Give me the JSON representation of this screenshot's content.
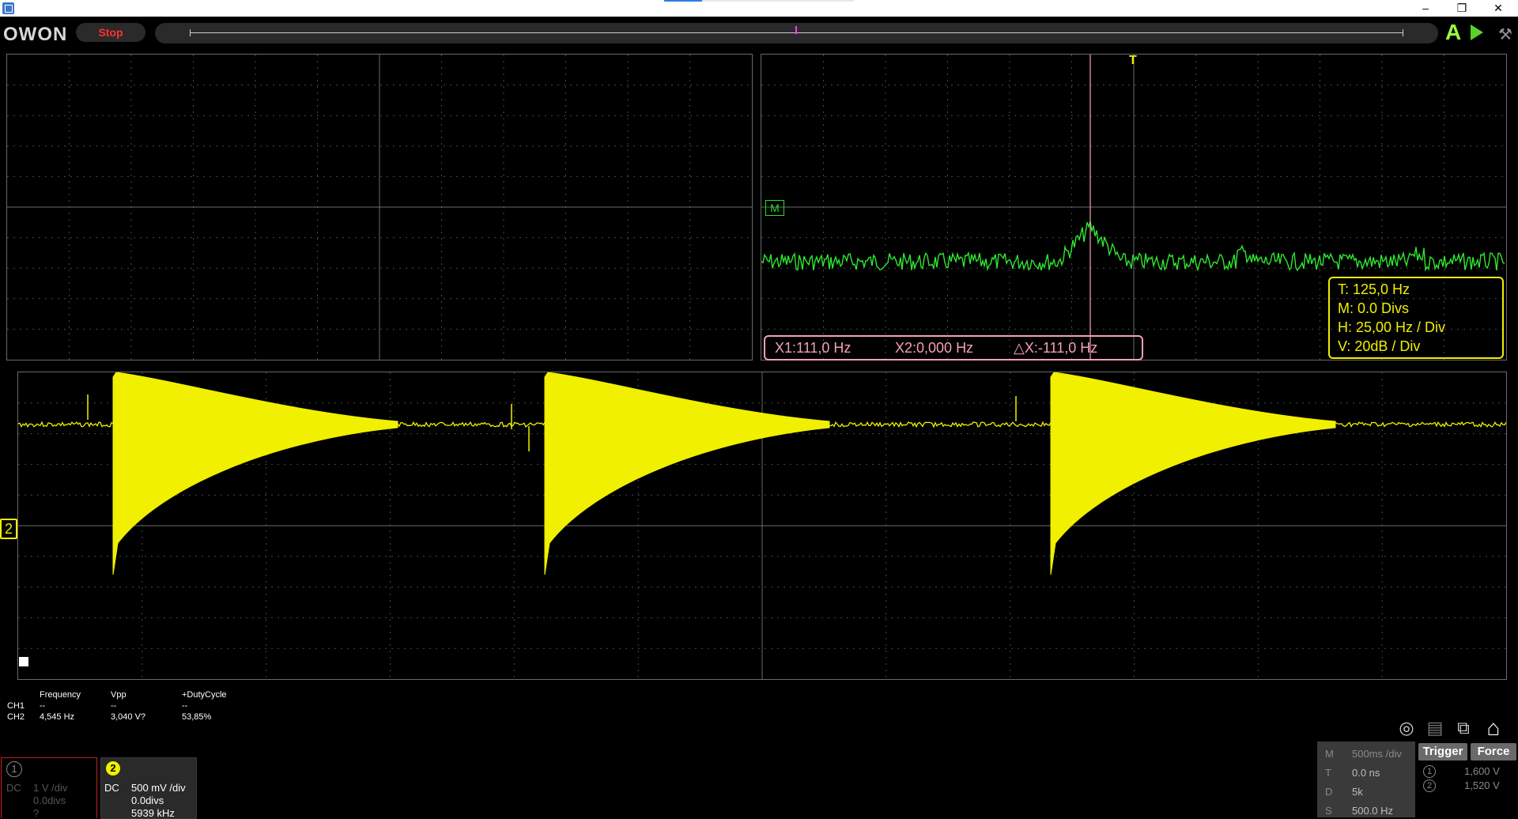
{
  "window": {
    "minimize": "–",
    "restore": "❐",
    "close": "✕"
  },
  "toolbar": {
    "logo": "OWON",
    "run_state": "Stop"
  },
  "fft": {
    "cursor": {
      "x1": "X1:111,0 Hz",
      "x2": "X2:0,000 Hz",
      "dx": "△X:-111,0 Hz"
    },
    "info": {
      "t": "T: 125,0 Hz",
      "m": "M: 0.0 Divs",
      "h": "H: 25,00 Hz / Div",
      "v": "V: 20dB  / Div"
    },
    "math_marker": "M",
    "trigger_marker": "T"
  },
  "channel_marker": "2",
  "measurements": {
    "headers": [
      "Frequency",
      "Vpp",
      "+DutyCycle"
    ],
    "rows": [
      {
        "ch": "CH1",
        "values": [
          "--",
          "--",
          "--"
        ]
      },
      {
        "ch": "CH2",
        "values": [
          "4,545 Hz",
          "3,040 V?",
          "53,85%"
        ]
      }
    ]
  },
  "ch1": {
    "num": "1",
    "coupling": "DC",
    "scale": "1 V /div",
    "offset": "0.0divs",
    "freq": "?"
  },
  "ch2": {
    "num": "2",
    "coupling": "DC",
    "scale": "500 mV /div",
    "offset": "0.0divs",
    "freq": "5939 kHz"
  },
  "horizontal": {
    "m_label": "M",
    "m_value": "500ms /div",
    "t_label": "T",
    "t_value": "0.0 ns",
    "d_label": "D",
    "d_value": "5k",
    "s_label": "S",
    "s_value": "500.0 Hz"
  },
  "trigger": {
    "trigger_label": "Trigger",
    "force_label": "Force",
    "level1_num": "1",
    "level1": "1,600 V",
    "level2_num": "2",
    "level2": "1,520 V"
  },
  "icons": [
    "screenshot-icon",
    "save-icon",
    "window-icon",
    "home-icon"
  ]
}
